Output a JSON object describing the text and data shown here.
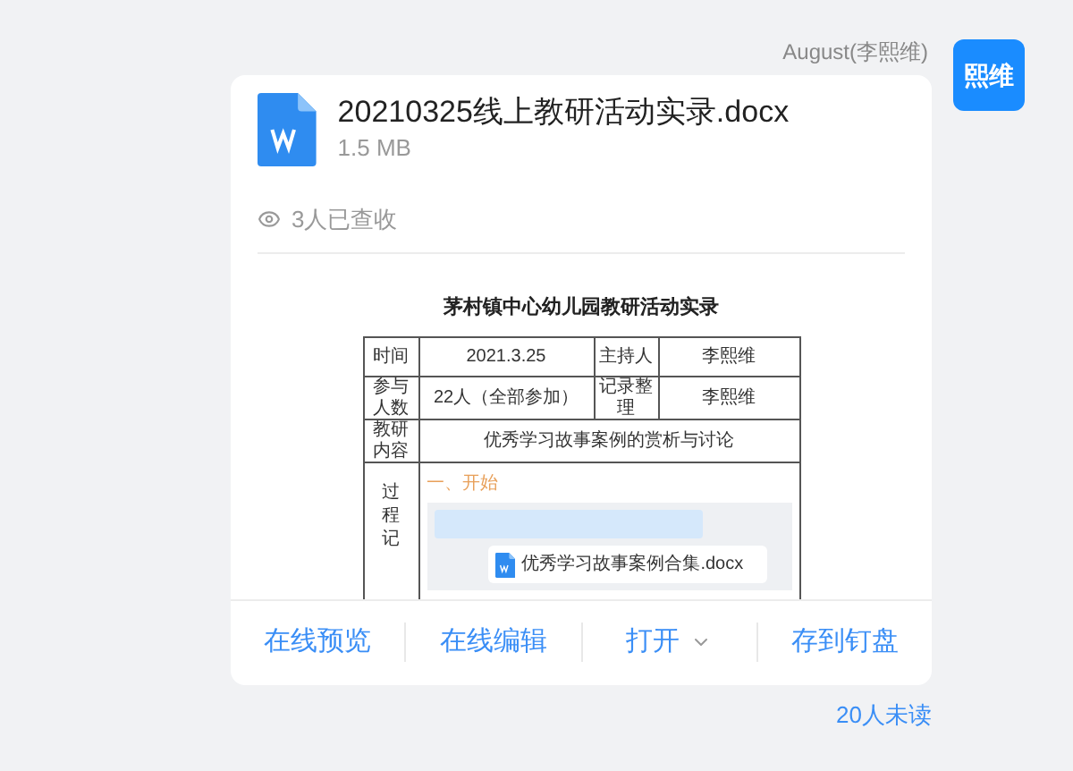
{
  "sender": {
    "name": "August(李熙维)",
    "avatar_text": "熙维"
  },
  "file": {
    "name": "20210325线上教研活动实录.docx",
    "size": "1.5 MB"
  },
  "receipt": "3人已查收",
  "preview": {
    "title": "茅村镇中心幼儿园教研活动实录",
    "info_rows": [
      {
        "kind": "pair",
        "cells": [
          "时间",
          "2021.3.25",
          "主持人",
          "李熙维"
        ]
      },
      {
        "kind": "pair",
        "cells": [
          "参与人数",
          "22人（全部参加）",
          "记录整理",
          "李熙维"
        ]
      },
      {
        "kind": "wide",
        "cells": [
          "教研内容",
          "优秀学习故事案例的赏析与讨论"
        ]
      }
    ],
    "process_label": "过程记",
    "section": "一、开始",
    "attachment": "优秀学习故事案例合集.docx"
  },
  "actions": [
    {
      "label": "在线预览",
      "kind": "link"
    },
    {
      "label": "在线编辑",
      "kind": "link"
    },
    {
      "label": "打开",
      "kind": "menu"
    },
    {
      "label": "存到钉盘",
      "kind": "link"
    }
  ],
  "unread": "20人未读"
}
